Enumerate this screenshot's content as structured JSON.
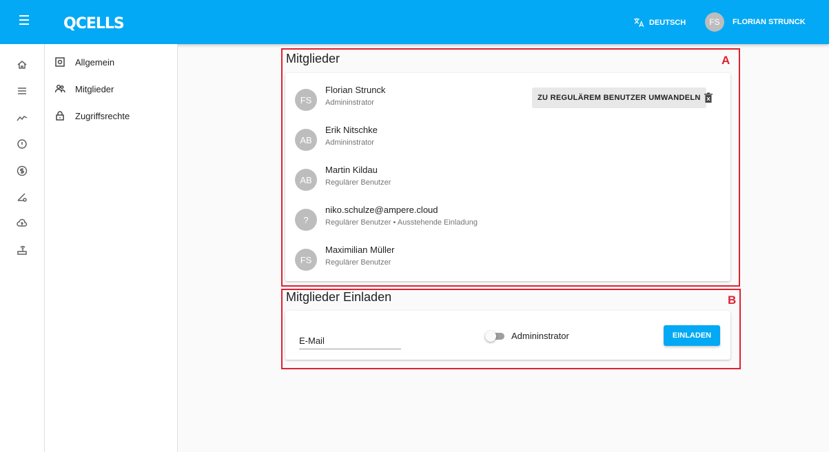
{
  "header": {
    "logo": "QCELLS",
    "language": "DEUTSCH",
    "user_initials": "FS",
    "user_name": "FLORIAN STRUNCK",
    "accent_color": "#03a9f4"
  },
  "rail_icons": [
    "home-icon",
    "list-icon",
    "trend-icon",
    "alert-icon",
    "dollar-icon",
    "pencil-settings-icon",
    "cloud-upload-icon",
    "router-icon"
  ],
  "subnav": {
    "items": [
      {
        "label": "Allgemein",
        "icon": "settings-box-icon"
      },
      {
        "label": "Mitglieder",
        "icon": "people-icon"
      },
      {
        "label": "Zugriffsrechte",
        "icon": "lock-icon"
      }
    ]
  },
  "members": {
    "title": "Mitglieder",
    "convert_label": "ZU REGULÄREM BENUTZER UMWANDELN",
    "list": [
      {
        "initials": "FS",
        "name": "Florian Strunck",
        "role": "Admininstrator"
      },
      {
        "initials": "AB",
        "name": "Erik Nitschke",
        "role": "Admininstrator"
      },
      {
        "initials": "AB",
        "name": "Martin Kildau",
        "role": "Regulärer Benutzer"
      },
      {
        "initials": "?",
        "name": "niko.schulze@ampere.cloud",
        "role": "Regulärer Benutzer • Ausstehende Einladung"
      },
      {
        "initials": "FS",
        "name": "Maximilian Müller",
        "role": "Regulärer Benutzer"
      }
    ]
  },
  "invite": {
    "title": "Mitglieder Einladen",
    "email_label": "E-Mail",
    "admin_label": "Admininstrator",
    "admin_toggle_on": false,
    "button_label": "EINLADEN"
  },
  "annotations": {
    "a": "A",
    "b": "B",
    "color": "#e02030"
  }
}
